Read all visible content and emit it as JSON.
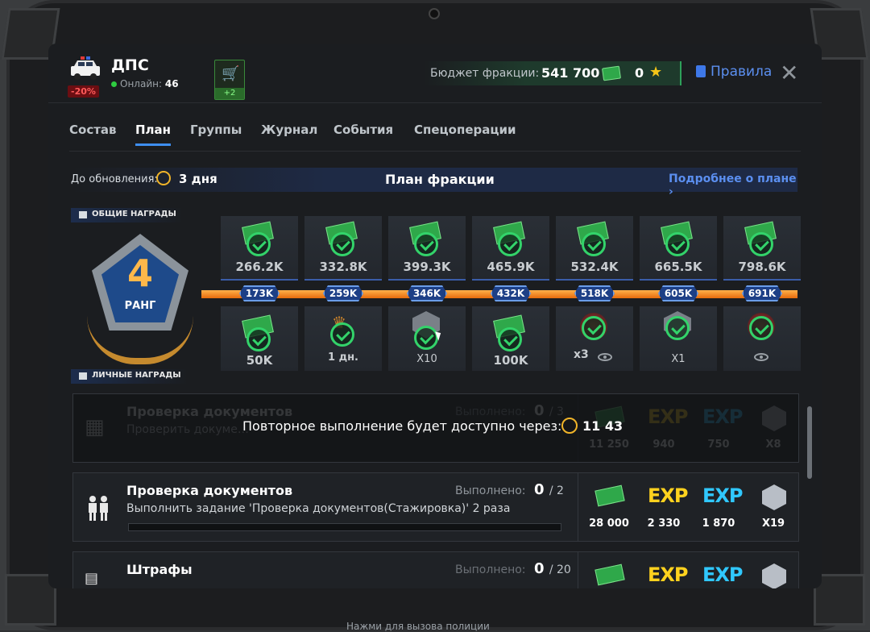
{
  "header": {
    "faction_name": "ДПС",
    "discount": "-20%",
    "online_label": "Онлайн:",
    "online_count": "46",
    "cart_badge": "+2",
    "budget_label": "Бюджет фракции:",
    "budget_value": "541 700",
    "stars": "0",
    "rules_label": "Правила",
    "close_glyph": "✕",
    "cart_glyph": "🛒"
  },
  "tabs": [
    "Состав",
    "План",
    "Группы",
    "Журнал",
    "События",
    "Спецоперации"
  ],
  "active_tab": "План",
  "plan": {
    "update_label": "До обновления:",
    "update_value": "3 дня",
    "title": "План фракции",
    "details_link": "Подробнее о плане ›",
    "common_rewards_label": "ОБЩИЕ НАГРАДЫ",
    "personal_rewards_label": "ЛИЧНЫЕ НАГРАДЫ",
    "rank_number": "4",
    "rank_label": "РАНГ",
    "top_rewards": [
      "266.2K",
      "332.8K",
      "399.3K",
      "465.9K",
      "532.4K",
      "665.5K",
      "798.6K"
    ],
    "milestones": [
      "173K",
      "259K",
      "346K",
      "432K",
      "518K",
      "605K",
      "691K"
    ],
    "bottom_rewards": [
      "50K",
      "1 дн.",
      "X10",
      "100K",
      "x3",
      "X1",
      ""
    ]
  },
  "tasks": [
    {
      "title": "Проверка документов",
      "desc": "Проверить докуме…",
      "progress_label": "Выполнено:",
      "progress_done": "0",
      "progress_total": "/ 3",
      "rewards": [
        "11 250",
        "940",
        "750",
        "X8"
      ],
      "overlay_text": "Повторное выполнение будет доступно через:",
      "overlay_timer": "11 43"
    },
    {
      "title": "Проверка документов",
      "desc": "Выполнить задание 'Проверка документов(Стажировка)' 2 раза",
      "progress_label": "Выполнено:",
      "progress_done": "0",
      "progress_total": "/ 2",
      "rewards": [
        "28 000",
        "2 330",
        "1 870",
        "X19"
      ]
    },
    {
      "title": "Штрафы",
      "progress_label": "Выполнено:",
      "progress_done": "0",
      "progress_total": "/ 20"
    }
  ],
  "exp_label": "EXP",
  "bottom_hint": "Нажми  для вызова полиции",
  "colors": {
    "accent_blue": "#3e8ef0",
    "check_green": "#33d36a",
    "track_orange": "#f0901e",
    "exp_gold": "#ffd21e",
    "exp_blue": "#30c8ff"
  }
}
